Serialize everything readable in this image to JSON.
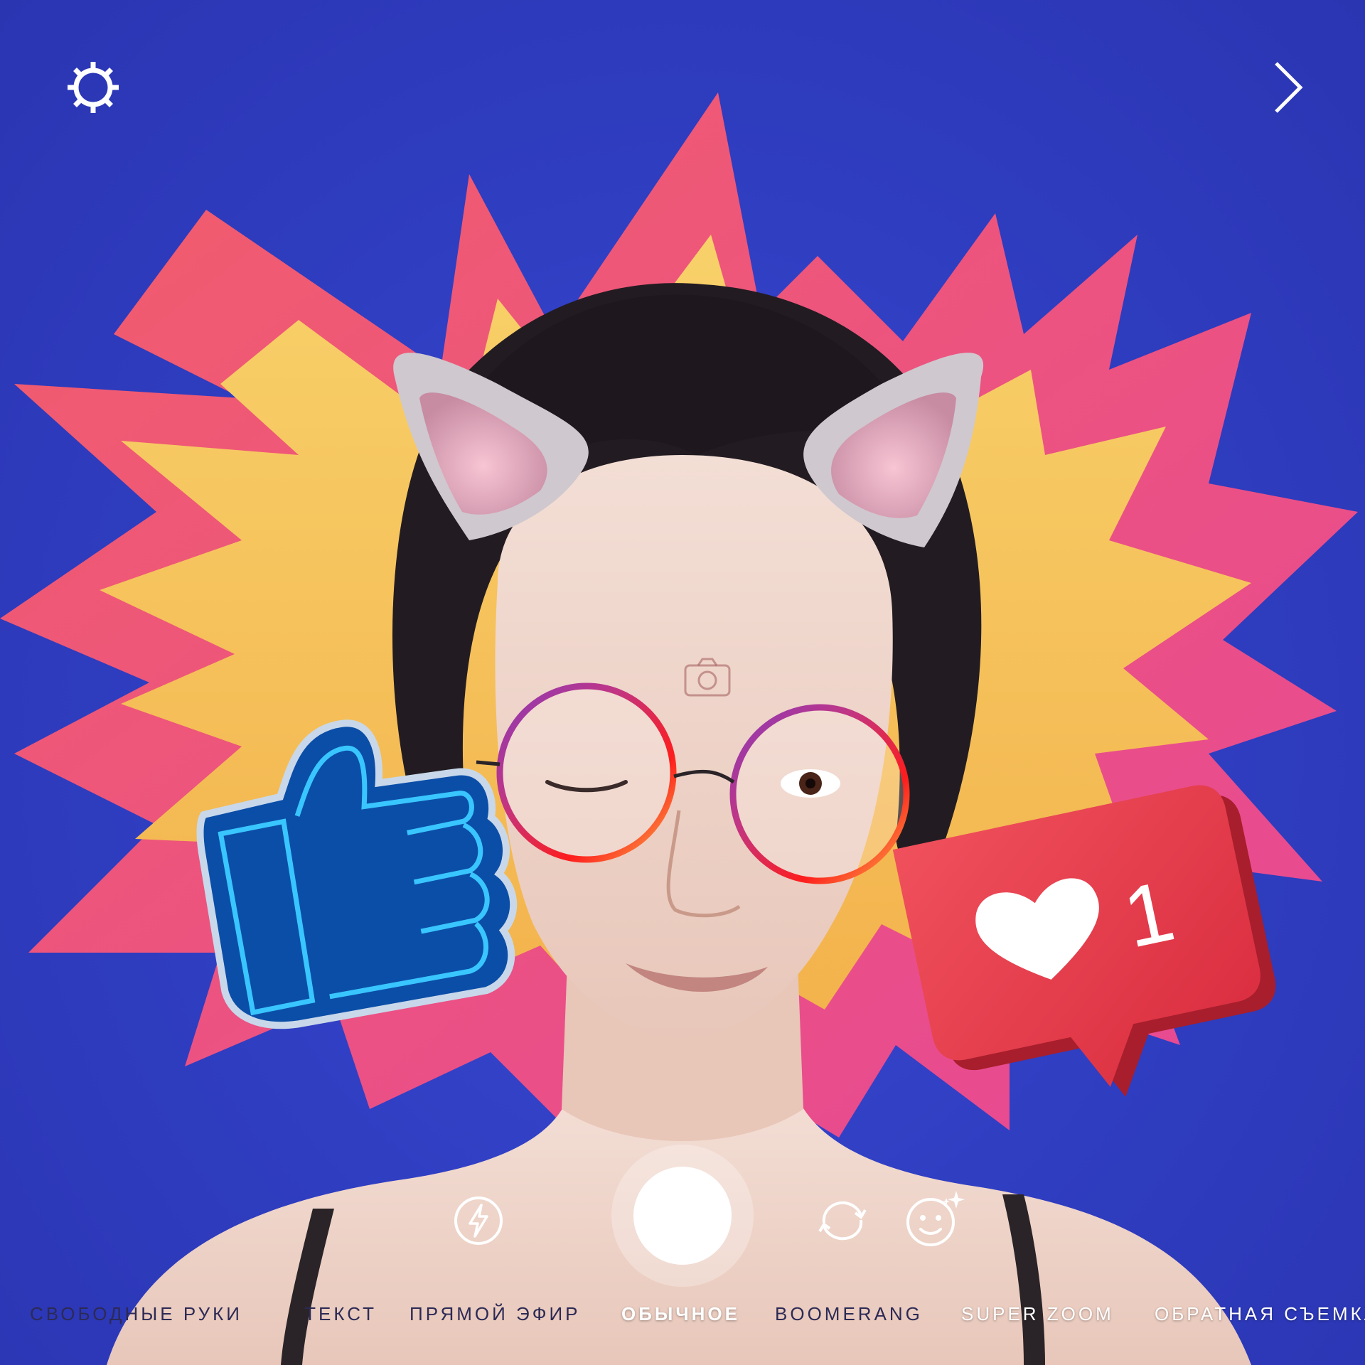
{
  "toolbar": {
    "settings_icon": "gear-icon",
    "next_icon": "chevron-right-icon"
  },
  "camera_controls": {
    "flash_icon": "flash-icon",
    "shutter": "shutter-button",
    "flip_icon": "flip-camera-icon",
    "effects_icon": "face-effects-icon",
    "capture_hint_icon": "camera-icon"
  },
  "stickers": {
    "like_count": "1",
    "like_icon": "heart-icon",
    "thumbs_up": "thumbs-up-neon-sticker"
  },
  "modes": [
    {
      "label": "СВОБОДНЫЕ РУКИ",
      "active": false
    },
    {
      "label": "ТЕКСТ",
      "active": false
    },
    {
      "label": "ПРЯМОЙ ЭФИР",
      "active": false
    },
    {
      "label": "ОБЫЧНОЕ",
      "active": true
    },
    {
      "label": "BOOMERANG",
      "active": false
    },
    {
      "label": "SUPER ZOOM",
      "active": false
    },
    {
      "label": "ОБРАТНАЯ СЪЕМКА",
      "active": false
    }
  ],
  "colors": {
    "background": "#2f3dc0",
    "burst_outer": "#f0506e",
    "burst_inner": "#f7c75a",
    "like_red": "#e63a4a",
    "neon_blue": "#1f8bff",
    "glasses_gradient_start": "#c13584",
    "glasses_gradient_end": "#fcaf45"
  }
}
